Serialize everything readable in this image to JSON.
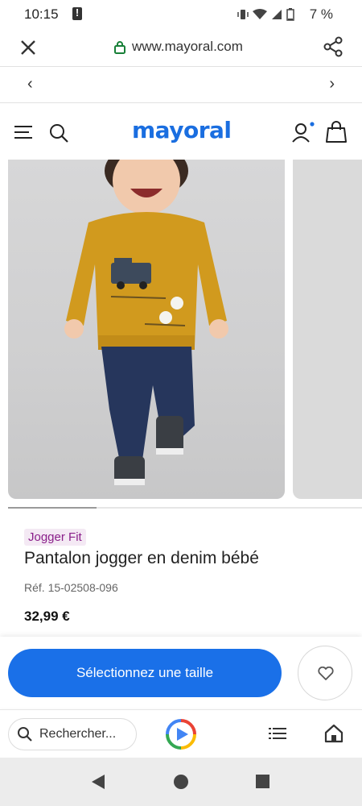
{
  "status_bar": {
    "time": "10:15",
    "battery_percent": "7 %",
    "icons": [
      "alert-icon",
      "vibrate-icon",
      "wifi-icon",
      "signal-icon",
      "battery-icon"
    ]
  },
  "browser": {
    "url": "www.mayoral.com",
    "search_placeholder": "Rechercher..."
  },
  "nav_arrows": {
    "left": "‹",
    "right": "›"
  },
  "site": {
    "logo": "mayoral",
    "brand_color": "#1a6ee0"
  },
  "gallery": {
    "progress": 0.25,
    "current_image": "product-photo-toddler-jogger-denim"
  },
  "product": {
    "tag": "Jogger Fit",
    "title": "Pantalon jogger en denim bébé",
    "ref": "Réf. 15-02508-096",
    "price": "32,99 €"
  },
  "actions": {
    "select_size": "Sélectionnez une taille",
    "accent_color": "#1a70e8"
  }
}
